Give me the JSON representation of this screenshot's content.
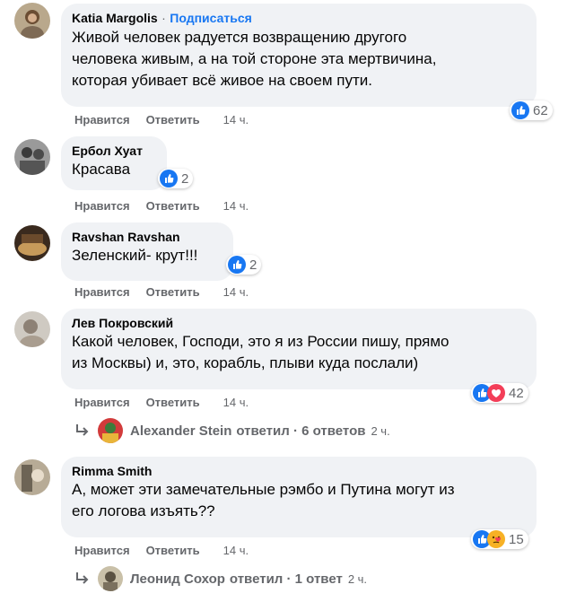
{
  "comments": [
    {
      "author": "Katia Margolis",
      "sep": "·",
      "subscribe": "Подписаться",
      "lines": [
        "Живой человек радуется возвращению другого",
        "человека живым, а на той стороне эта мертвичина,",
        "которая убивает всё живое на своем пути."
      ],
      "like": "Нравится",
      "reply": "Ответить",
      "time": "14 ч.",
      "reactions": "62"
    },
    {
      "author": "Ербол Хуат",
      "lines": [
        "Красава"
      ],
      "like": "Нравится",
      "reply": "Ответить",
      "time": "14 ч.",
      "reactions": "2"
    },
    {
      "author": "Ravshan Ravshan",
      "lines": [
        "Зеленский- крут!!!"
      ],
      "like": "Нравится",
      "reply": "Ответить",
      "time": "14 ч.",
      "reactions": "2"
    },
    {
      "author": "Лев Покровский",
      "lines": [
        "Какой человек, Господи, это я из России пишу, прямо",
        "из Москвы) и, это, корабль, плыви куда послали)"
      ],
      "like": "Нравится",
      "reply": "Ответить",
      "time": "14 ч.",
      "reactions": "42",
      "replies": {
        "name": "Alexander Stein",
        "text": "ответил · 6 ответов",
        "time": "2 ч."
      }
    },
    {
      "author": "Rimma Smith",
      "lines": [
        "А, может эти замечательные рэмбо и Путина могут из",
        "его логова изъять??"
      ],
      "like": "Нравится",
      "reply": "Ответить",
      "time": "14 ч.",
      "reactions": "15",
      "replies": {
        "name": "Леонид Сохор",
        "text": "ответил · 1 ответ",
        "time": "2 ч."
      }
    }
  ],
  "colors": {
    "like_blue": "#1877f2",
    "heart_red": "#f33e58",
    "care_yellow": "#f7b125",
    "bubble_gray": "#f0f2f5",
    "meta_gray": "#65676b"
  },
  "icons": [
    "like-icon",
    "love-icon",
    "care-icon",
    "reply-arrow-icon"
  ]
}
